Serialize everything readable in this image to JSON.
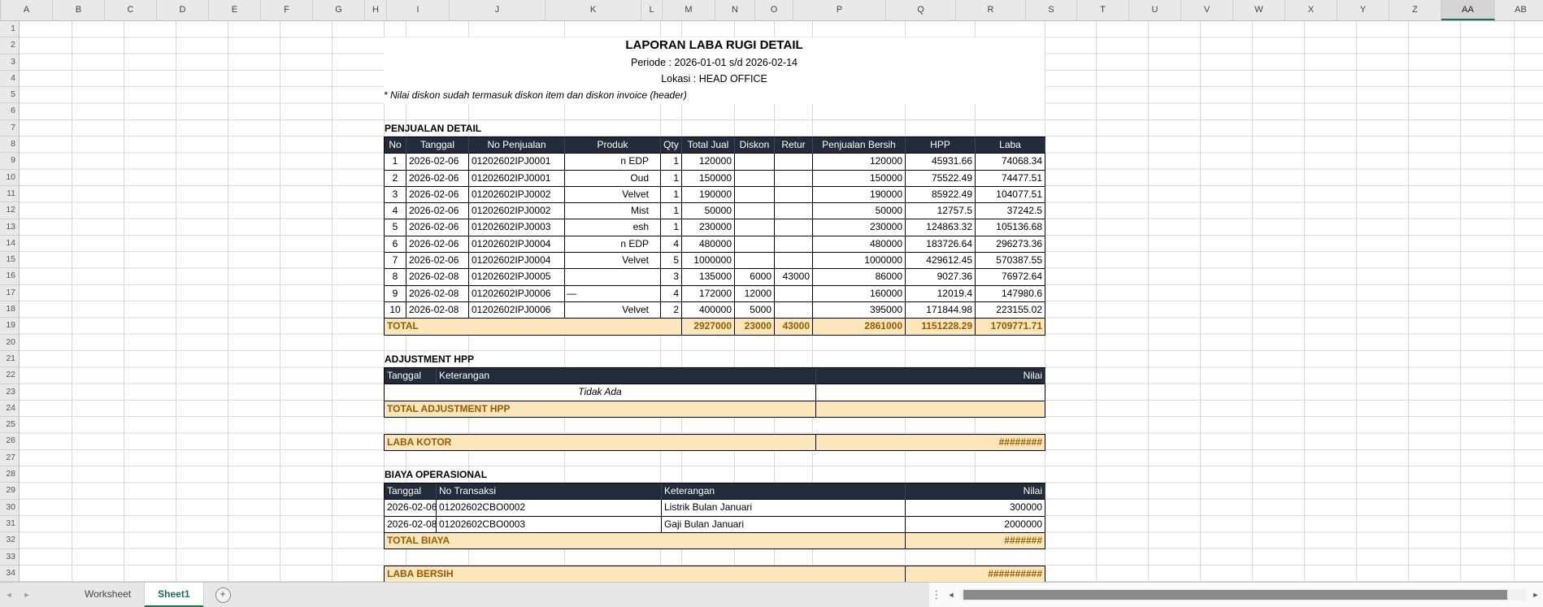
{
  "colors": {
    "accent_green": "#217346",
    "header_bg": "#212b39",
    "total_bg": "#fbe7bb",
    "total_text": "#9c5700"
  },
  "columns": {
    "letters": [
      "A",
      "B",
      "C",
      "D",
      "E",
      "F",
      "G",
      "H",
      "I",
      "J",
      "K",
      "L",
      "M",
      "N",
      "O",
      "P",
      "Q",
      "R",
      "S",
      "T",
      "U",
      "V",
      "W",
      "X",
      "Y",
      "Z",
      "AA",
      "AB"
    ],
    "selected": "AA"
  },
  "rows": {
    "count": 34
  },
  "report": {
    "title": "LAPORAN LABA RUGI DETAIL",
    "periode": "Periode : 2026-01-01 s/d 2026-02-14",
    "lokasi": "Lokasi : HEAD OFFICE",
    "note": "* Nilai diskon sudah termasuk diskon item dan diskon invoice (header)"
  },
  "penjualan": {
    "section_title": "PENJUALAN DETAIL",
    "headers": [
      "No",
      "Tanggal",
      "No Penjualan",
      "Produk",
      "Qty",
      "Total Jual",
      "Diskon",
      "Retur",
      "Penjualan Bersih",
      "HPP",
      "Laba"
    ],
    "rows": [
      [
        "1",
        "2026-02-06",
        "01202602IPJ0001",
        "n EDP",
        "1",
        "120000",
        "",
        "",
        "120000",
        "45931.66",
        "74068.34"
      ],
      [
        "2",
        "2026-02-06",
        "01202602IPJ0001",
        "Oud",
        "1",
        "150000",
        "",
        "",
        "150000",
        "75522.49",
        "74477.51"
      ],
      [
        "3",
        "2026-02-06",
        "01202602IPJ0002",
        "Velvet",
        "1",
        "190000",
        "",
        "",
        "190000",
        "85922.49",
        "104077.51"
      ],
      [
        "4",
        "2026-02-06",
        "01202602IPJ0002",
        "Mist",
        "1",
        "50000",
        "",
        "",
        "50000",
        "12757.5",
        "37242.5"
      ],
      [
        "5",
        "2026-02-06",
        "01202602IPJ0003",
        "esh",
        "1",
        "230000",
        "",
        "",
        "230000",
        "124863.32",
        "105136.68"
      ],
      [
        "6",
        "2026-02-06",
        "01202602IPJ0004",
        "n EDP",
        "4",
        "480000",
        "",
        "",
        "480000",
        "183726.64",
        "296273.36"
      ],
      [
        "7",
        "2026-02-06",
        "01202602IPJ0004",
        "Velvet",
        "5",
        "1000000",
        "",
        "",
        "1000000",
        "429612.45",
        "570387.55"
      ],
      [
        "8",
        "2026-02-08",
        "01202602IPJ0005",
        "",
        "3",
        "135000",
        "6000",
        "43000",
        "86000",
        "9027.36",
        "76972.64"
      ],
      [
        "9",
        "2026-02-08",
        "01202602IPJ0006",
        "—",
        "4",
        "172000",
        "12000",
        "",
        "160000",
        "12019.4",
        "147980.6"
      ],
      [
        "10",
        "2026-02-08",
        "01202602IPJ0006",
        "Velvet",
        "2",
        "400000",
        "5000",
        "",
        "395000",
        "171844.98",
        "223155.02"
      ]
    ],
    "total": {
      "label": "TOTAL",
      "values": [
        "2927000",
        "23000",
        "43000",
        "2861000",
        "1151228.29",
        "1709771.71"
      ]
    }
  },
  "adjustment": {
    "section_title": "ADJUSTMENT HPP",
    "headers": [
      "Tanggal",
      "Keterangan",
      "Nilai"
    ],
    "empty_text": "Tidak Ada",
    "total_label": "TOTAL ADJUSTMENT HPP",
    "total_value": ""
  },
  "laba_kotor": {
    "label": "LABA KOTOR",
    "value": "########"
  },
  "biaya": {
    "section_title": "BIAYA OPERASIONAL",
    "headers": [
      "Tanggal",
      "No Transaksi",
      "Keterangan",
      "Nilai"
    ],
    "rows": [
      [
        "2026-02-06",
        "01202602CBO0002",
        "Listrik Bulan Januari",
        "300000"
      ],
      [
        "2026-02-08",
        "01202602CBO0003",
        "Gaji Bulan Januari",
        "2000000"
      ]
    ],
    "total_label": "TOTAL BIAYA",
    "total_value": "#######"
  },
  "laba_bersih": {
    "label": "LABA BERSIH",
    "value": "##########"
  },
  "tabbar": {
    "nav_prev": "◄",
    "nav_next": "►",
    "tabs": [
      {
        "label": "Worksheet",
        "active": false
      },
      {
        "label": "Sheet1",
        "active": true
      }
    ],
    "add_icon": "+",
    "dots": "⋮",
    "scroll_left": "◄",
    "scroll_right": "►"
  }
}
